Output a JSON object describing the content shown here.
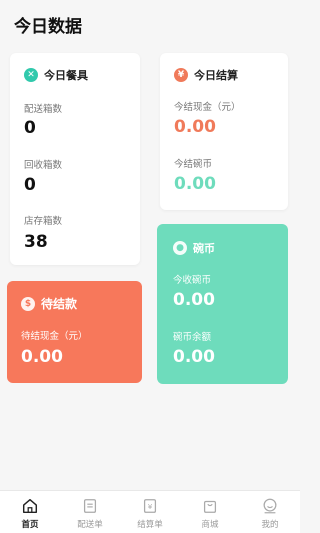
{
  "page": {
    "title": "今日数据"
  },
  "tableware": {
    "title": "今日餐具",
    "icon": "close-circle-icon",
    "accent": "#31c9ac",
    "stats": [
      {
        "label": "配送箱数",
        "value": "0"
      },
      {
        "label": "回收箱数",
        "value": "0"
      },
      {
        "label": "店存箱数",
        "value": "38"
      }
    ]
  },
  "settlement": {
    "title": "今日结算",
    "icon": "yen-icon",
    "accent": "#f07a5a",
    "stats": [
      {
        "label": "今结现金（元）",
        "value": "0.00",
        "color": "#f07a5a"
      },
      {
        "label": "今结碗币",
        "value": "0.00",
        "color": "#6edcbc"
      }
    ]
  },
  "pending": {
    "title": "待结款",
    "icon": "money-bag-icon",
    "bg": "#f7785b",
    "stats": [
      {
        "label": "待结现金（元）",
        "value": "0.00"
      }
    ]
  },
  "coin": {
    "title": "碗币",
    "icon": "coin-icon",
    "bg": "#6edcbc",
    "stats": [
      {
        "label": "今收碗币",
        "value": "0.00"
      },
      {
        "label": "碗币余额",
        "value": "0.00"
      }
    ]
  },
  "tabbar": {
    "items": [
      {
        "label": "首页",
        "icon": "home-icon",
        "active": true
      },
      {
        "label": "配送单",
        "icon": "document-icon",
        "active": false
      },
      {
        "label": "结算单",
        "icon": "receipt-icon",
        "active": false
      },
      {
        "label": "商城",
        "icon": "shopping-bag-icon",
        "active": false
      },
      {
        "label": "我的",
        "icon": "user-icon",
        "active": false
      }
    ]
  }
}
